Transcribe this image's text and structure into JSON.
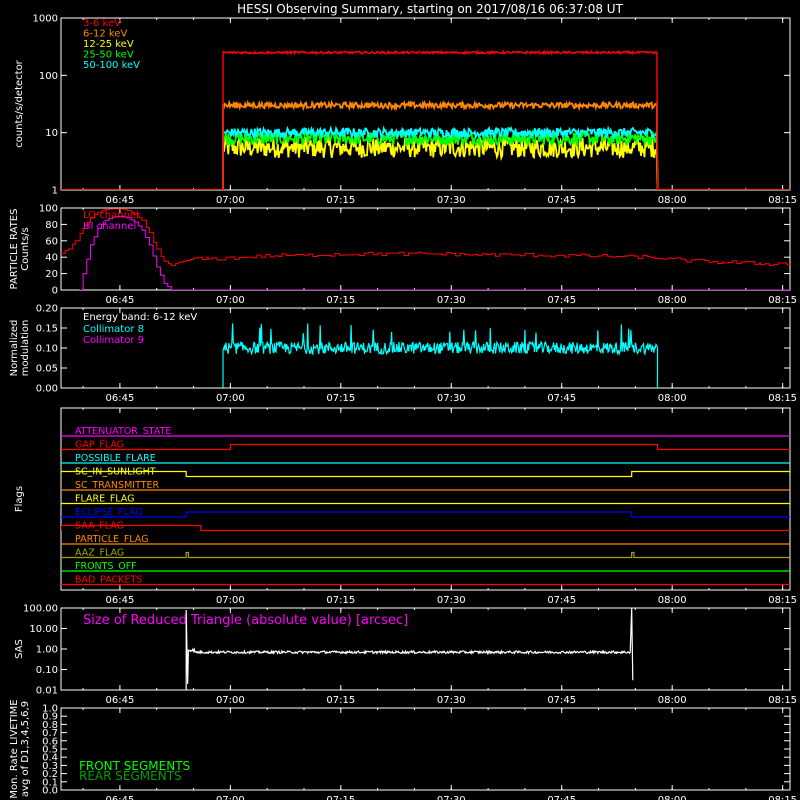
{
  "title": "HESSI Observing Summary, starting on 2017/08/16 06:37:08 UT",
  "x_ticks": [
    "06:45",
    "07:00",
    "07:15",
    "07:30",
    "07:45",
    "08:00",
    "08:15"
  ],
  "x_tick_minutes": [
    8,
    23,
    38,
    53,
    68,
    83,
    98
  ],
  "x_range_minutes": [
    0,
    99
  ],
  "colors": {
    "background": "#000000",
    "axis": "#ffffff",
    "red": "#ff0000",
    "orange": "#ff8800",
    "yellow": "#ffff00",
    "green": "#00ff00",
    "cyan": "#00ffff",
    "magenta": "#ff00ff",
    "blue": "#0000ff",
    "olive": "#a5a500",
    "darkgreen": "#00a000",
    "white": "#ffffff"
  },
  "chart_data": [
    {
      "type": "line",
      "id": "count-rates",
      "title": "HESSI Observing Summary, starting on 2017/08/16 06:37:08 UT",
      "ylabel": "counts/s/detector",
      "y_scale": "log",
      "ylim": [
        1,
        1000
      ],
      "y_ticks": [
        "1",
        "10",
        "100",
        "1000"
      ],
      "y_tick_values": [
        1,
        10,
        100,
        1000
      ],
      "legend_position": "top-left",
      "active_interval_minutes": [
        22,
        81
      ],
      "series": [
        {
          "name": "3-6 keV",
          "color": "red",
          "level": 250,
          "noise": 0.02
        },
        {
          "name": "6-12 keV",
          "color": "orange",
          "level": 30,
          "noise": 0.05
        },
        {
          "name": "12-25 keV",
          "color": "yellow",
          "level": 5.5,
          "noise": 0.18
        },
        {
          "name": "25-50 keV",
          "color": "green",
          "level": 8,
          "noise": 0.12
        },
        {
          "name": "50-100 keV",
          "color": "cyan",
          "level": 10,
          "noise": 0.08
        }
      ]
    },
    {
      "type": "line",
      "id": "particle-rates",
      "ylabel": "PARTICLE RATES Counts/s",
      "ylim": [
        0,
        100
      ],
      "y_ticks": [
        "0",
        "20",
        "40",
        "60",
        "80",
        "100"
      ],
      "y_tick_values": [
        0,
        20,
        40,
        60,
        80,
        100
      ],
      "legend_position": "top-left",
      "series": [
        {
          "name": "LO channel",
          "color": "red"
        },
        {
          "name": "HI channel",
          "color": "magenta"
        }
      ],
      "lo_channel_points": [
        [
          0,
          45
        ],
        [
          1,
          50
        ],
        [
          2,
          60
        ],
        [
          3,
          75
        ],
        [
          4,
          88
        ],
        [
          5,
          95
        ],
        [
          6,
          98
        ],
        [
          7,
          99
        ],
        [
          8,
          99
        ],
        [
          9,
          97
        ],
        [
          10,
          93
        ],
        [
          11,
          85
        ],
        [
          12,
          70
        ],
        [
          13,
          50
        ],
        [
          14,
          35
        ],
        [
          15,
          30
        ],
        [
          16,
          34
        ],
        [
          17,
          36
        ],
        [
          18,
          38
        ],
        [
          20,
          38
        ],
        [
          30,
          42
        ],
        [
          40,
          44
        ],
        [
          50,
          44
        ],
        [
          60,
          43
        ],
        [
          70,
          42
        ],
        [
          80,
          40
        ],
        [
          85,
          36
        ],
        [
          90,
          34
        ],
        [
          95,
          32
        ],
        [
          99,
          32
        ]
      ],
      "hi_channel_points": [
        [
          2.5,
          0
        ],
        [
          3,
          20
        ],
        [
          4,
          55
        ],
        [
          5,
          75
        ],
        [
          6,
          85
        ],
        [
          7,
          89
        ],
        [
          8,
          90
        ],
        [
          9,
          88
        ],
        [
          10,
          83
        ],
        [
          11,
          73
        ],
        [
          12,
          55
        ],
        [
          13,
          28
        ],
        [
          14,
          8
        ],
        [
          15,
          0
        ],
        [
          99,
          0
        ]
      ]
    },
    {
      "type": "line",
      "id": "modulation",
      "ylabel": "Normalized modulation",
      "ylim": [
        0,
        0.2
      ],
      "y_ticks": [
        "0.00",
        "0.05",
        "0.10",
        "0.15",
        "0.20"
      ],
      "y_tick_values": [
        0,
        0.05,
        0.1,
        0.15,
        0.2
      ],
      "annotation": "Energy band: 6-12 keV",
      "legend_position": "top-left",
      "active_interval_minutes": [
        22,
        81
      ],
      "series": [
        {
          "name": "Collimator 8",
          "color": "cyan",
          "level": 0.1,
          "noise": 0.015
        },
        {
          "name": "Collimator 9",
          "color": "magenta"
        }
      ]
    },
    {
      "type": "line",
      "id": "flags",
      "ylabel": "Flags",
      "flags": [
        {
          "name": "ATTENUATOR_STATE",
          "color": "magenta",
          "steps": []
        },
        {
          "name": "GAP_FLAG",
          "color": "red",
          "steps": [
            [
              23,
              81
            ]
          ]
        },
        {
          "name": "POSSIBLE_FLARE",
          "color": "cyan",
          "steps": []
        },
        {
          "name": "SC_IN_SUNLIGHT",
          "color": "yellow",
          "steps": [
            [
              0,
              17
            ],
            [
              77.5,
              99
            ]
          ]
        },
        {
          "name": "SC_TRANSMITTER",
          "color": "orange",
          "steps": []
        },
        {
          "name": "FLARE_FLAG",
          "color": "yellow",
          "steps": []
        },
        {
          "name": "ECLIPSE_FLAG",
          "color": "blue",
          "steps": [
            [
              17,
              77.5
            ]
          ]
        },
        {
          "name": "SAA_FLAG",
          "color": "red",
          "steps": [
            [
              0,
              19
            ]
          ]
        },
        {
          "name": "PARTICLE_FLAG",
          "color": "orange",
          "steps": []
        },
        {
          "name": "AAZ_FLAG",
          "color": "olive",
          "steps": [
            [
              17,
              17.3
            ],
            [
              77.5,
              77.8
            ]
          ]
        },
        {
          "name": "FRONTS_OFF",
          "color": "green",
          "steps": []
        },
        {
          "name": "BAD_PACKETS",
          "color": "red",
          "steps": []
        }
      ]
    },
    {
      "type": "line",
      "id": "sas",
      "ylabel": "SAS",
      "y_scale": "log",
      "ylim": [
        0.01,
        100
      ],
      "y_ticks": [
        "0.01",
        "0.10",
        "1.00",
        "10.00",
        "100.00"
      ],
      "y_tick_values": [
        0.01,
        0.1,
        1,
        10,
        100
      ],
      "annotation": "Size of Reduced Triangle (absolute value) [arcsec]",
      "active_interval_minutes": [
        17,
        77.5
      ],
      "series": [
        {
          "name": "Size of Reduced Triangle",
          "color": "white",
          "level": 0.7
        }
      ]
    },
    {
      "type": "line",
      "id": "livetime",
      "ylabel": "Mon. Rate LIVETIME avg of D1,3,4,5,6,9",
      "ylim": [
        0,
        1.0
      ],
      "y_ticks": [
        "0.0",
        "0.1",
        "0.2",
        "0.3",
        "0.4",
        "0.5",
        "0.6",
        "0.7",
        "0.8",
        "0.9",
        "1.0"
      ],
      "y_tick_values": [
        0,
        0.1,
        0.2,
        0.3,
        0.4,
        0.5,
        0.6,
        0.7,
        0.8,
        0.9,
        1.0
      ],
      "legend_position": "bottom-left",
      "series": [
        {
          "name": "FRONT SEGMENTS",
          "color": "green"
        },
        {
          "name": "REAR SEGMENTS",
          "color": "darkgreen"
        }
      ]
    }
  ]
}
